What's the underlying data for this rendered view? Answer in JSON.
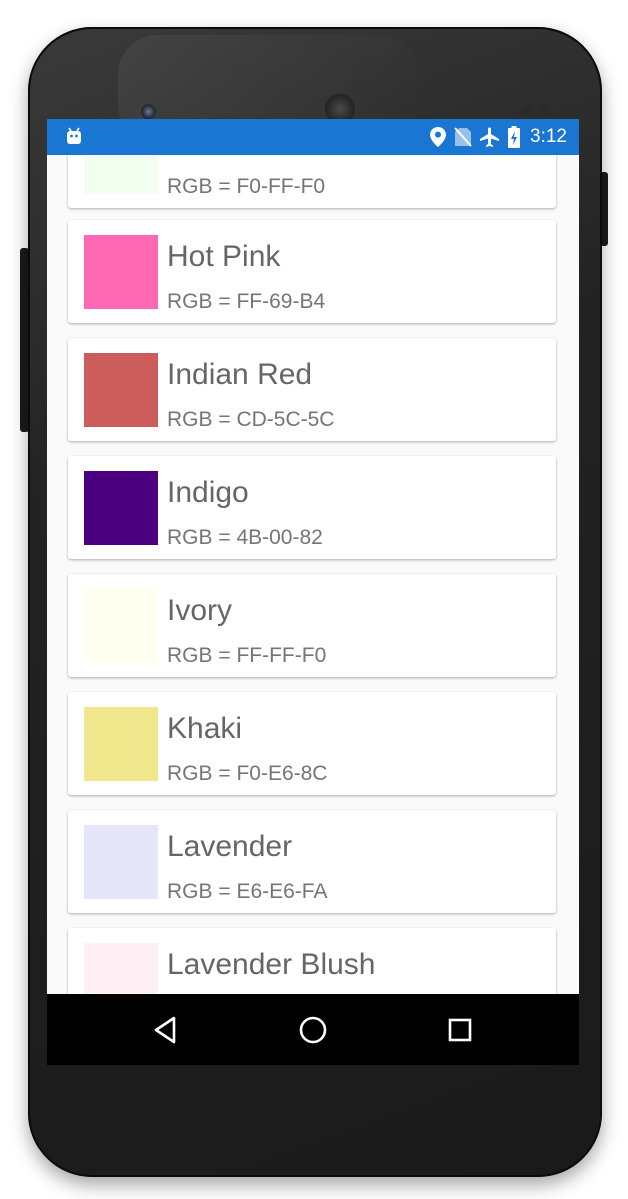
{
  "status_bar": {
    "time": "3:12",
    "icons": [
      "android-icon",
      "location-icon",
      "no-sim-icon",
      "airplane-icon",
      "battery-charging-icon"
    ],
    "color": "#1976d2"
  },
  "colors": [
    {
      "name": "",
      "rgb": "RGB = F0-FF-F0",
      "hex": "#F0FFF0"
    },
    {
      "name": "Hot Pink",
      "rgb": "RGB = FF-69-B4",
      "hex": "#FF69B4"
    },
    {
      "name": "Indian Red",
      "rgb": "RGB = CD-5C-5C",
      "hex": "#CD5C5C"
    },
    {
      "name": "Indigo",
      "rgb": "RGB = 4B-00-82",
      "hex": "#4B0082"
    },
    {
      "name": "Ivory",
      "rgb": "RGB = FF-FF-F0",
      "hex": "#FFFFF0"
    },
    {
      "name": "Khaki",
      "rgb": "RGB = F0-E6-8C",
      "hex": "#F0E68C"
    },
    {
      "name": "Lavender",
      "rgb": "RGB = E6-E6-FA",
      "hex": "#E6E6FA"
    },
    {
      "name": "Lavender Blush",
      "rgb": "",
      "hex": "#FFF0F5"
    }
  ],
  "nav_bar": {
    "buttons": [
      "back-icon",
      "home-icon",
      "recents-icon"
    ]
  }
}
